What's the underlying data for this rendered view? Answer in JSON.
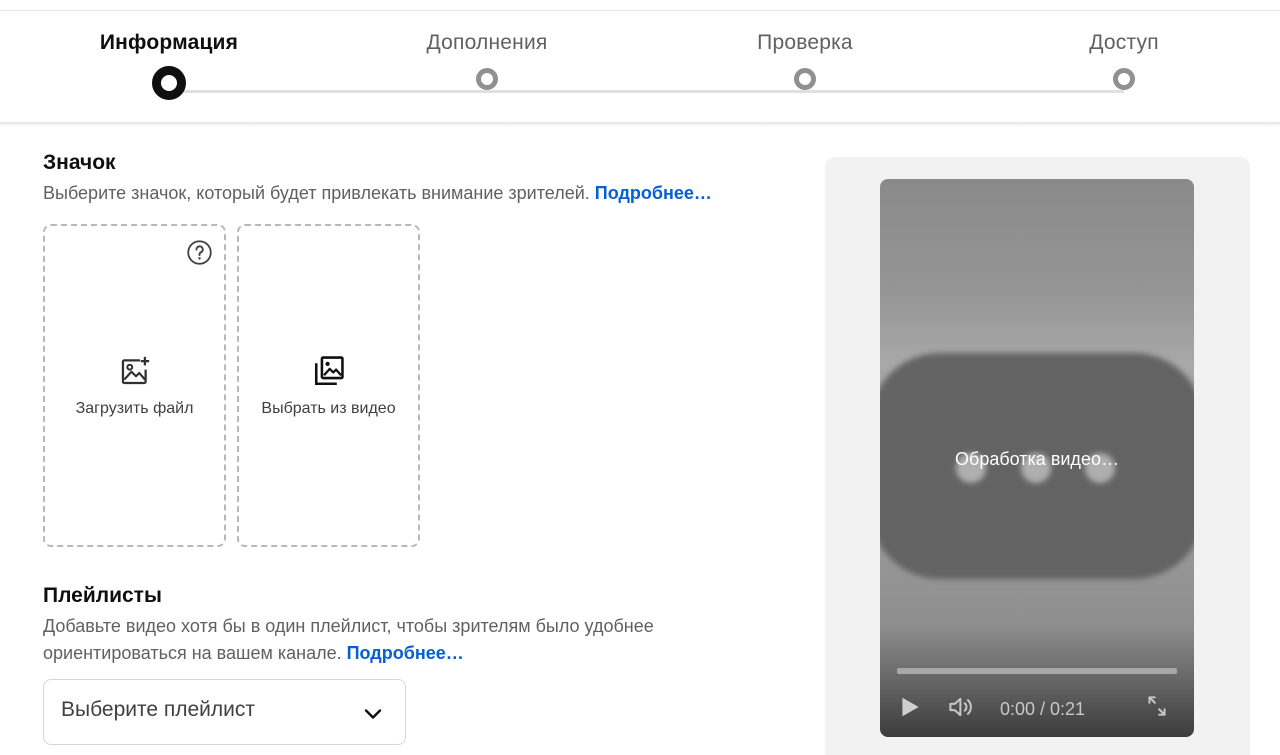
{
  "stepper": {
    "steps": [
      {
        "label": "Информация",
        "state": "active"
      },
      {
        "label": "Дополнения",
        "state": "pending"
      },
      {
        "label": "Проверка",
        "state": "pending"
      },
      {
        "label": "Доступ",
        "state": "pending"
      }
    ]
  },
  "thumbnail": {
    "title": "Значок",
    "description": "Выберите значок, который будет привлекать внимание зрителей.",
    "link": "Подробнее…",
    "cards": [
      {
        "label": "Загрузить файл",
        "icon": "add-photo-icon"
      },
      {
        "label": "Выбрать из видео",
        "icon": "photo-library-icon"
      }
    ]
  },
  "playlists": {
    "title": "Плейлисты",
    "description_line1": "Добавьте видео хотя бы в один плейлист, чтобы зрителям было удобнее",
    "description_line2": "ориентироваться на вашем канале.",
    "link": "Подробнее…",
    "select_placeholder": "Выберите плейлист"
  },
  "preview": {
    "status": "Обработка видео…",
    "time": "0:00 / 0:21",
    "progress": 0
  },
  "colors": {
    "link": "#065fd4",
    "active_step": "#0f0f0f",
    "inactive_step": "#909090"
  }
}
